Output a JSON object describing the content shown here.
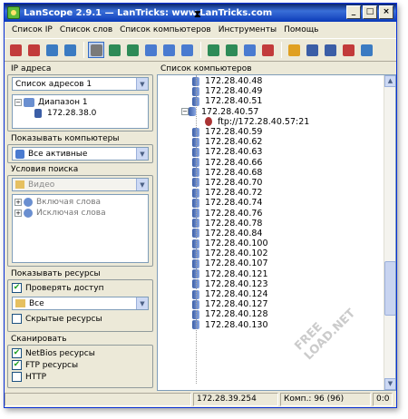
{
  "window": {
    "title": "LanScope 2.9.1 — LanTricks: www.LanTricks.com"
  },
  "menu": [
    "Список IP",
    "Список слов",
    "Список компьютеров",
    "Инструменты",
    "Помощь"
  ],
  "toolbar": {
    "colors": [
      "#c23b3b",
      "#c23b3b",
      "#3b7bc2",
      "#3b7bc2",
      "#7a7a7a",
      "#2e8b57",
      "#2e8b57",
      "#4a7bd0",
      "#4a7bd0",
      "#4a7bd0",
      "#2e8b57",
      "#2e8b57",
      "#4a7bd0",
      "#c23b3b",
      "#e0a020",
      "#3b5ea6",
      "#3b5ea6",
      "#c23b3b",
      "#3b7bc2"
    ]
  },
  "left": {
    "ip_title": "IP адреса",
    "ip_combo": "Список адресов 1",
    "tree": {
      "range": "Диапазон 1",
      "ip": "172.28.38.0"
    },
    "show_title": "Показывать компьютеры",
    "show_combo": "Все активные",
    "search_title": "Условия поиска",
    "search_combo": "Видео",
    "include": "Включая слова",
    "exclude": "Исключая слова",
    "res_title": "Показывать ресурсы",
    "check_access": "Проверять доступ",
    "res_combo": "Все",
    "hidden": "Скрытые ресурсы",
    "scan_title": "Сканировать",
    "netbios": "NetBios ресурсы",
    "ftp": "FTP ресурсы",
    "http": "HTTP"
  },
  "right": {
    "title": "Список компьютеров",
    "rows": [
      "172.28.40.48",
      "172.28.40.49",
      "172.28.40.51",
      "172.28.40.57",
      "ftp://172.28.40.57:21",
      "172.28.40.59",
      "172.28.40.62",
      "172.28.40.63",
      "172.28.40.66",
      "172.28.40.68",
      "172.28.40.70",
      "172.28.40.72",
      "172.28.40.74",
      "172.28.40.76",
      "172.28.40.78",
      "172.28.40.84",
      "172.28.40.100",
      "172.28.40.102",
      "172.28.40.107",
      "172.28.40.121",
      "172.28.40.123",
      "172.28.40.124",
      "172.28.40.127",
      "172.28.40.128",
      "172.28.40.130"
    ]
  },
  "status": {
    "current_ip": "172.28.39.254",
    "count": "Комп.: 96 (96)",
    "time": "0:0"
  },
  "watermark": "FREE LOAD.NET"
}
